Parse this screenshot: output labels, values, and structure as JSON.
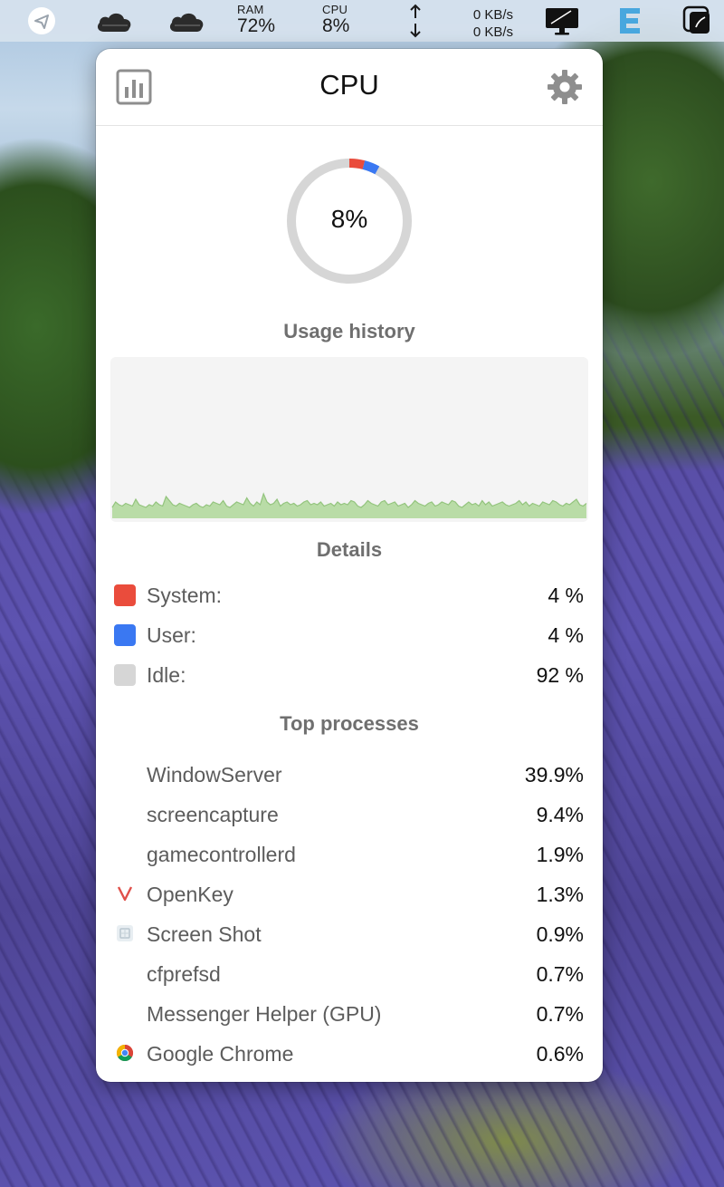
{
  "menubar": {
    "ram": {
      "label": "RAM",
      "value": "72%"
    },
    "cpu": {
      "label": "CPU",
      "value": "8%"
    },
    "network": {
      "upload": "0 KB/s",
      "download": "0 KB/s"
    },
    "icons": [
      "telegram-icon",
      "cloud-icon",
      "cloud-icon",
      "network-arrows-icon",
      "display-icon",
      "e-app-icon",
      "screenshot-app-icon"
    ]
  },
  "popover": {
    "title": "CPU",
    "gauge": {
      "value_label": "8%",
      "system_fraction": 0.04,
      "user_fraction": 0.04
    },
    "usage_history_title": "Usage history",
    "details_title": "Details",
    "details": [
      {
        "name": "System:",
        "value": "4 %",
        "color": "#ea4c3c"
      },
      {
        "name": "User:",
        "value": "4 %",
        "color": "#3a78f2"
      },
      {
        "name": "Idle:",
        "value": "92 %",
        "color": "#d6d6d6"
      }
    ],
    "top_processes_title": "Top processes",
    "processes": [
      {
        "name": "WindowServer",
        "value": "39.9%",
        "icon": ""
      },
      {
        "name": "screencapture",
        "value": "9.4%",
        "icon": ""
      },
      {
        "name": "gamecontrollerd",
        "value": "1.9%",
        "icon": ""
      },
      {
        "name": "OpenKey",
        "value": "1.3%",
        "icon": "openkey-icon"
      },
      {
        "name": "Screen Shot",
        "value": "0.9%",
        "icon": "screen-shot-icon"
      },
      {
        "name": "cfprefsd",
        "value": "0.7%",
        "icon": ""
      },
      {
        "name": "Messenger Helper (GPU)",
        "value": "0.7%",
        "icon": ""
      },
      {
        "name": "Google Chrome",
        "value": "0.6%",
        "icon": "chrome-icon"
      }
    ]
  },
  "chart_data": {
    "type": "area",
    "title": "Usage history",
    "ylim": [
      0,
      100
    ],
    "values": [
      8,
      12,
      10,
      9,
      11,
      10,
      9,
      14,
      10,
      9,
      8,
      10,
      9,
      12,
      10,
      9,
      16,
      13,
      10,
      9,
      11,
      10,
      9,
      8,
      10,
      11,
      9,
      8,
      10,
      9,
      12,
      11,
      10,
      13,
      9,
      8,
      10,
      12,
      11,
      10,
      15,
      11,
      9,
      12,
      10,
      18,
      12,
      10,
      11,
      14,
      9,
      11,
      12,
      10,
      11,
      9,
      10,
      12,
      13,
      10,
      11,
      10,
      12,
      9,
      10,
      11,
      9,
      12,
      10,
      11,
      10,
      13,
      12,
      9,
      8,
      10,
      13,
      11,
      10,
      9,
      12,
      13,
      10,
      11,
      12,
      9,
      10,
      11,
      8,
      10,
      13,
      11,
      10,
      9,
      11,
      12,
      9,
      10,
      12,
      11,
      10,
      13,
      12,
      9,
      8,
      10,
      12,
      10,
      11,
      9,
      13,
      10,
      12,
      9,
      10,
      11,
      12,
      10,
      9,
      10,
      11,
      13,
      10,
      12,
      9,
      11,
      10,
      9,
      12,
      11,
      10,
      13,
      12,
      10,
      9,
      11,
      10,
      12,
      14,
      10,
      9,
      11
    ]
  }
}
